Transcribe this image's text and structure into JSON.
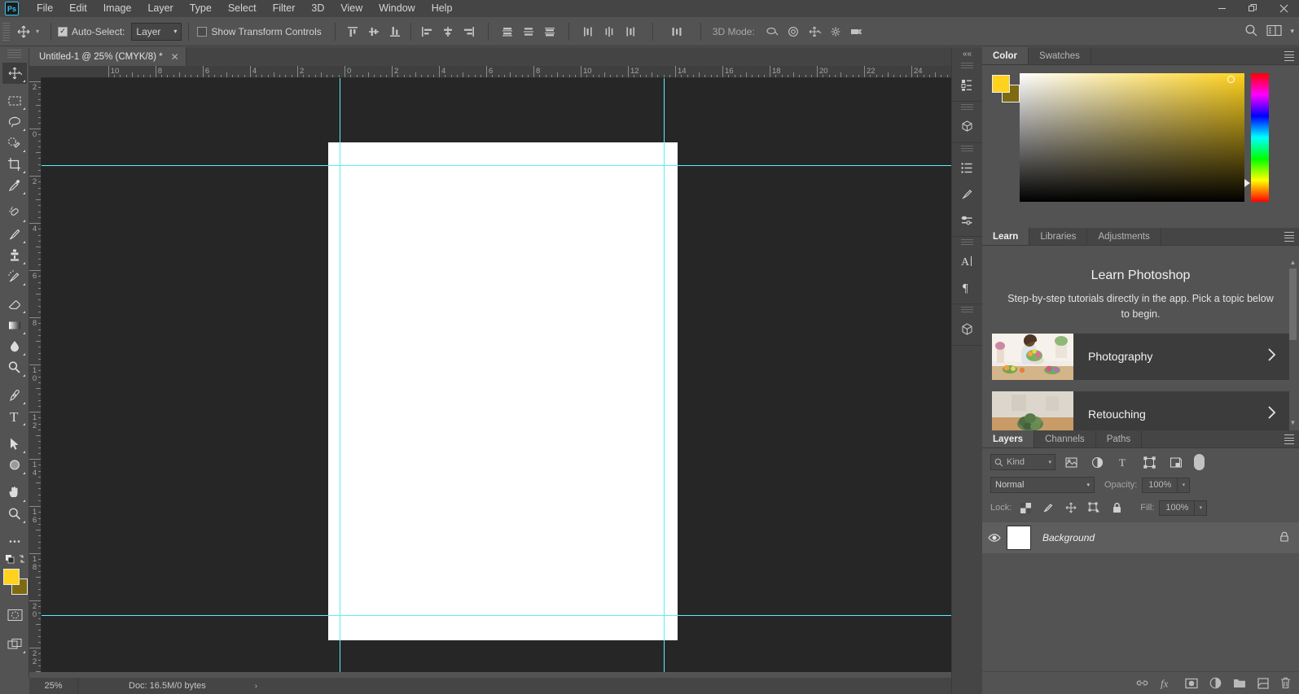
{
  "app": {
    "logo": "Ps",
    "name": "Adobe Photoshop"
  },
  "window_controls": {
    "minimize": "—",
    "restore": "❐",
    "close": "✕"
  },
  "menubar": {
    "items": [
      "File",
      "Edit",
      "Image",
      "Layer",
      "Type",
      "Select",
      "Filter",
      "3D",
      "View",
      "Window",
      "Help"
    ]
  },
  "options_bar": {
    "tool_icon": "move-tool-icon",
    "auto_select_label": "Auto-Select:",
    "auto_select_checked": true,
    "auto_select_scope": "Layer",
    "show_transform_label": "Show Transform Controls",
    "show_transform_checked": false,
    "align_icons": [
      "align-top-edges",
      "align-vertical-centers",
      "align-bottom-edges",
      "align-left-edges",
      "align-horizontal-centers",
      "align-right-edges"
    ],
    "distribute_icons": [
      "distribute-left-edges",
      "distribute-horizontal-centers",
      "distribute-right-edges"
    ],
    "extra_icons": [
      "distribute-spacing"
    ],
    "mode3d_label": "3D Mode:",
    "mode3d_icons": [
      "orbit-3d-icon",
      "roll-3d-icon",
      "pan-3d-icon",
      "slide-3d-icon",
      "zoom-3d-camera-icon"
    ],
    "right_icons": [
      "search-icon",
      "workspace-switcher-icon",
      "chevron-down-icon"
    ]
  },
  "document": {
    "tab_title": "Untitled-1 @ 25% (CMYK/8) *",
    "close_glyph": "✕"
  },
  "toolbar": {
    "tools": [
      {
        "name": "move-tool",
        "active": true
      },
      {
        "name": "rectangular-marquee-tool",
        "active": false
      },
      {
        "name": "lasso-tool",
        "active": false
      },
      {
        "name": "quick-selection-tool",
        "active": false
      },
      {
        "name": "crop-tool",
        "active": false
      },
      {
        "name": "eyedropper-tool",
        "active": false
      },
      {
        "name": "spot-healing-brush-tool",
        "active": false
      },
      {
        "name": "brush-tool",
        "active": false
      },
      {
        "name": "clone-stamp-tool",
        "active": false
      },
      {
        "name": "history-brush-tool",
        "active": false
      },
      {
        "name": "eraser-tool",
        "active": false
      },
      {
        "name": "gradient-tool",
        "active": false
      },
      {
        "name": "blur-tool",
        "active": false
      },
      {
        "name": "dodge-tool",
        "active": false
      },
      {
        "name": "pen-tool",
        "active": false
      },
      {
        "name": "type-tool",
        "active": false
      },
      {
        "name": "path-selection-tool",
        "active": false
      },
      {
        "name": "ellipse-tool",
        "active": false
      },
      {
        "name": "hand-tool",
        "active": false
      },
      {
        "name": "zoom-tool",
        "active": false
      },
      {
        "name": "edit-toolbar-tool",
        "active": false
      }
    ],
    "foreground_color": "#ffd21e",
    "background_color": "#7d6a13",
    "quick_mask_icon": "quick-mask-icon",
    "screen_mode_icon": "screen-mode-icon"
  },
  "rulers": {
    "unit": "inches",
    "h_labels": [
      "10",
      "8",
      "6",
      "4",
      "2",
      "0",
      "2",
      "4",
      "6",
      "8",
      "10",
      "12",
      "14",
      "16",
      "18",
      "20",
      "22",
      "24",
      "2"
    ],
    "v_labels": [
      "2",
      "0",
      "2",
      "4",
      "6",
      "8",
      "10",
      "12",
      "14",
      "16",
      "18",
      "20",
      "22"
    ]
  },
  "canvas": {
    "zoom": "25%",
    "background": "#262626",
    "page_color": "#ffffff",
    "guide_color": "#59f0f5",
    "guides": {
      "vertical": [
        402,
        800
      ],
      "horizontal": [
        188,
        741
      ]
    }
  },
  "dock_rail": {
    "collapse_glyph": "««",
    "icons": [
      "history-panel-icon",
      "layer-comps-icon",
      "3d-panel-icon",
      "properties-icon",
      "brush-settings-icon",
      "brush-presets-icon",
      "character-panel-icon",
      "paragraph-panel-icon",
      "3d-object-icon"
    ]
  },
  "color_panel": {
    "tabs": [
      {
        "label": "Color",
        "active": true
      },
      {
        "label": "Swatches",
        "active": false
      }
    ],
    "foreground": "#ffd21e",
    "background": "#7d6a13",
    "picker_type": "hue-cube",
    "menu_icon": "panel-menu-icon"
  },
  "learn_panel": {
    "tabs": [
      {
        "label": "Learn",
        "active": true
      },
      {
        "label": "Libraries",
        "active": false
      },
      {
        "label": "Adjustments",
        "active": false
      }
    ],
    "title": "Learn Photoshop",
    "subtitle": "Step-by-step tutorials directly in the app. Pick a topic below to begin.",
    "cards": [
      {
        "label": "Photography",
        "arrow": "›",
        "thumb": "woman-arranging-flowers-photo"
      },
      {
        "label": "Retouching",
        "arrow": "›",
        "thumb": "flowers-on-table-photo"
      }
    ],
    "menu_icon": "panel-menu-icon"
  },
  "layers_panel": {
    "tabs": [
      {
        "label": "Layers",
        "active": true
      },
      {
        "label": "Channels",
        "active": false
      },
      {
        "label": "Paths",
        "active": false
      }
    ],
    "filter_kind_label": "Kind",
    "filter_icons": [
      "filter-pixel-icon",
      "filter-adjustment-icon",
      "filter-type-icon",
      "filter-shape-icon",
      "filter-smart-object-icon"
    ],
    "filter_toggle": "filter-enable-toggle",
    "blend_mode": "Normal",
    "opacity_label": "Opacity:",
    "opacity_value": "100%",
    "lock_label": "Lock:",
    "lock_icons": [
      "lock-transparent-pixels-icon",
      "lock-image-pixels-icon",
      "lock-position-icon",
      "lock-artboard-nesting-icon",
      "lock-all-icon"
    ],
    "fill_label": "Fill:",
    "fill_value": "100%",
    "layers": [
      {
        "name": "Background",
        "visible": true,
        "locked": true,
        "thumb_color": "#ffffff"
      }
    ],
    "footer_icons": [
      "link-layers-icon",
      "add-layer-style-icon",
      "add-layer-mask-icon",
      "new-adjustment-layer-icon",
      "new-group-icon",
      "new-layer-icon",
      "delete-layer-icon"
    ],
    "menu_icon": "panel-menu-icon"
  },
  "status_bar": {
    "zoom": "25%",
    "doc_info": "Doc: 16.5M/0 bytes",
    "expand_glyph": "›"
  },
  "colors": {
    "titlebar_bg": "#454545",
    "chrome_bg": "#535353",
    "panel_bg": "#535353",
    "canvas_bg": "#262626",
    "accent_blue": "#31c5f0",
    "guide_cyan": "#59f0f5"
  }
}
